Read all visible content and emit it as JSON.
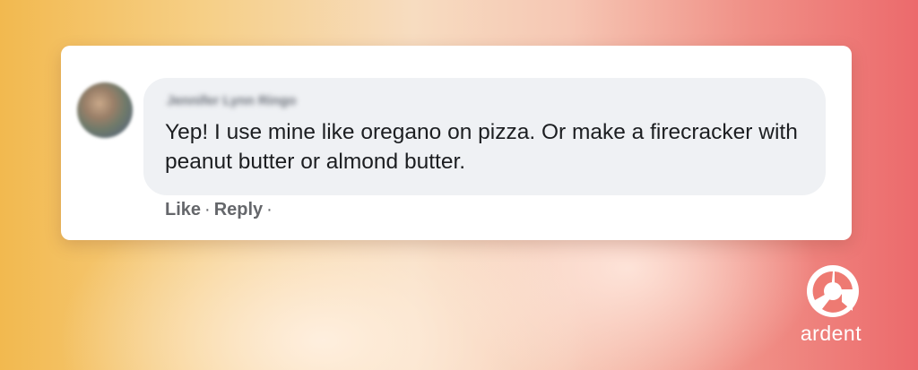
{
  "comment": {
    "author": "Jennifer Lynn Ringo",
    "text": "Yep! I use mine like oregano on pizza. Or make a firecracker with peanut butter or almond butter.",
    "actions": {
      "like_label": "Like",
      "reply_label": "Reply",
      "separator": "·"
    }
  },
  "brand": {
    "name": "ardent",
    "icon": "ardent-logo-icon"
  },
  "colors": {
    "bubble_background": "#eff1f4",
    "card_background": "#ffffff",
    "text_primary": "#1c1e21",
    "text_secondary": "#65676b",
    "gradient_left": "#f2b94f",
    "gradient_right": "#ec6a6c"
  }
}
